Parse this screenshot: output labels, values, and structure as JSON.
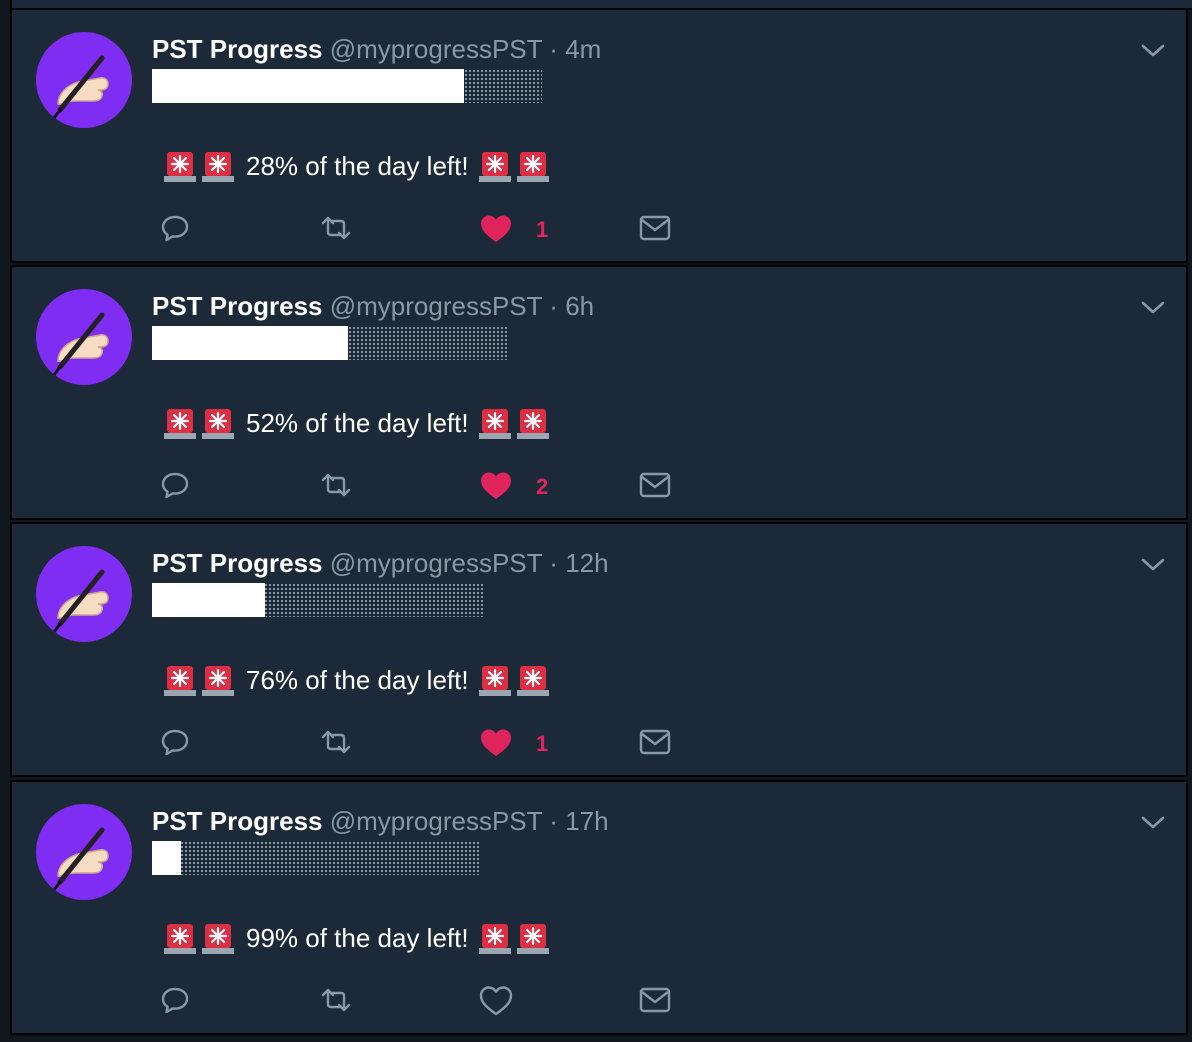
{
  "colors": {
    "background": "#10171e",
    "card": "#1c2938",
    "avatar": "#7f2cf3",
    "muted": "#8899a6",
    "like": "#e0245e",
    "text": "#ffffff"
  },
  "tweets": [
    {
      "name": "PST Progress",
      "handle": "@myprogressPST",
      "separator": "·",
      "time": "4m",
      "progress_fraction_filled": 0.8,
      "message": "28% of the day left!",
      "reply_icon": "reply-icon",
      "retweet_icon": "retweet-icon",
      "like_icon": "heart-filled-icon",
      "liked": true,
      "like_count": "1",
      "dm_icon": "envelope-icon"
    },
    {
      "name": "PST Progress",
      "handle": "@myprogressPST",
      "separator": "·",
      "time": "6h",
      "progress_fraction_filled": 0.55,
      "message": "52% of the day left!",
      "reply_icon": "reply-icon",
      "retweet_icon": "retweet-icon",
      "like_icon": "heart-filled-icon",
      "liked": true,
      "like_count": "2",
      "dm_icon": "envelope-icon"
    },
    {
      "name": "PST Progress",
      "handle": "@myprogressPST",
      "separator": "·",
      "time": "12h",
      "progress_fraction_filled": 0.34,
      "message": "76% of the day left!",
      "reply_icon": "reply-icon",
      "retweet_icon": "retweet-icon",
      "like_icon": "heart-filled-icon",
      "liked": true,
      "like_count": "1",
      "dm_icon": "envelope-icon"
    },
    {
      "name": "PST Progress",
      "handle": "@myprogressPST",
      "separator": "·",
      "time": "17h",
      "progress_fraction_filled": 0.09,
      "message": "99% of the day left!",
      "reply_icon": "reply-icon",
      "retweet_icon": "retweet-icon",
      "like_icon": "heart-outline-icon",
      "liked": false,
      "like_count": "",
      "dm_icon": "envelope-icon"
    }
  ]
}
